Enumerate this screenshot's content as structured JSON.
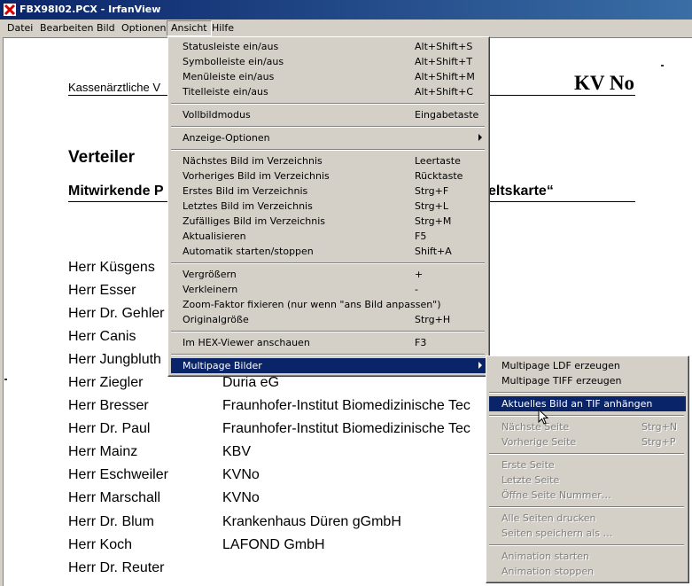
{
  "window": {
    "title": "FBX98I02.PCX - IrfanView"
  },
  "menubar": {
    "items": [
      "Datei",
      "Bearbeiten",
      "Bild",
      "Optionen",
      "Ansicht",
      "Hilfe"
    ]
  },
  "document": {
    "header_left": "Kassenärztliche V",
    "header_right": "KV No",
    "heading": "Verteiler",
    "subheading_left": "Mitwirkende P",
    "subheading_right": "eltskarte“",
    "rows": [
      {
        "name": "Herr Küsgens",
        "org": ""
      },
      {
        "name": "Herr Esser",
        "org": ""
      },
      {
        "name": "Herr Dr. Gehler",
        "org": ""
      },
      {
        "name": "Herr Canis",
        "org": ""
      },
      {
        "name": "Herr Jungbluth",
        "org": ""
      },
      {
        "name": "Herr Ziegler",
        "org": "Duria eG"
      },
      {
        "name": "Herr Bresser",
        "org": "Fraunhofer-Institut Biomedizinische Tec"
      },
      {
        "name": "Herr Dr. Paul",
        "org": "Fraunhofer-Institut Biomedizinische Tec"
      },
      {
        "name": "Herr Mainz",
        "org": "KBV"
      },
      {
        "name": "Herr Eschweiler",
        "org": "KVNo"
      },
      {
        "name": "Herr Marschall",
        "org": "KVNo"
      },
      {
        "name": "Herr Dr. Blum",
        "org": "Krankenhaus Düren gGmbH"
      },
      {
        "name": "Herr Koch",
        "org": "LAFOND GmbH"
      },
      {
        "name": "Herr Dr. Reuter",
        "org": ""
      }
    ]
  },
  "ansicht_menu": {
    "items": [
      {
        "label": "Statusleiste ein/aus",
        "shortcut": "Alt+Shift+S"
      },
      {
        "label": "Symbolleiste ein/aus",
        "shortcut": "Alt+Shift+T"
      },
      {
        "label": "Menüleiste ein/aus",
        "shortcut": "Alt+Shift+M"
      },
      {
        "label": "Titelleiste ein/aus",
        "shortcut": "Alt+Shift+C"
      },
      {
        "label": "Vollbildmodus",
        "shortcut": "Eingabetaste"
      },
      {
        "label": "Anzeige-Optionen",
        "shortcut": ""
      },
      {
        "label": "Nächstes Bild im Verzeichnis",
        "shortcut": "Leertaste"
      },
      {
        "label": "Vorheriges Bild im Verzeichnis",
        "shortcut": "Rücktaste"
      },
      {
        "label": "Erstes Bild im Verzeichnis",
        "shortcut": "Strg+F"
      },
      {
        "label": "Letztes Bild im Verzeichnis",
        "shortcut": "Strg+L"
      },
      {
        "label": "Zufälliges Bild im Verzeichnis",
        "shortcut": "Strg+M"
      },
      {
        "label": "Aktualisieren",
        "shortcut": "F5"
      },
      {
        "label": "Automatik starten/stoppen",
        "shortcut": "Shift+A"
      },
      {
        "label": "Vergrößern",
        "shortcut": "+"
      },
      {
        "label": "Verkleinern",
        "shortcut": "-"
      },
      {
        "label": "Zoom-Faktor fixieren (nur wenn \"ans Bild anpassen\")",
        "shortcut": ""
      },
      {
        "label": "Originalgröße",
        "shortcut": "Strg+H"
      },
      {
        "label": "Im HEX-Viewer anschauen",
        "shortcut": "F3"
      },
      {
        "label": "Multipage Bilder",
        "shortcut": ""
      }
    ]
  },
  "multipage_menu": {
    "items": [
      {
        "label": "Multipage LDF erzeugen",
        "shortcut": ""
      },
      {
        "label": "Multipage TIFF erzeugen",
        "shortcut": ""
      },
      {
        "label": "Aktuelles Bild an TIF anhängen",
        "shortcut": ""
      },
      {
        "label": "Nächste Seite",
        "shortcut": "Strg+N"
      },
      {
        "label": "Vorherige Seite",
        "shortcut": "Strg+P"
      },
      {
        "label": "Erste Seite",
        "shortcut": ""
      },
      {
        "label": "Letzte Seite",
        "shortcut": ""
      },
      {
        "label": "Öffne Seite Nummer…",
        "shortcut": ""
      },
      {
        "label": "Alle Seiten drucken",
        "shortcut": ""
      },
      {
        "label": "Seiten speichern als …",
        "shortcut": ""
      },
      {
        "label": "Animation starten",
        "shortcut": ""
      },
      {
        "label": "Animation stoppen",
        "shortcut": ""
      }
    ]
  },
  "colors": {
    "title_bar": "#0a246a",
    "highlight": "#0a246a",
    "face": "#d4d0c8",
    "disabled": "#808080"
  },
  "icons": [
    "irfanview-app-icon",
    "submenu-arrow-icon",
    "mouse-cursor-icon"
  ]
}
